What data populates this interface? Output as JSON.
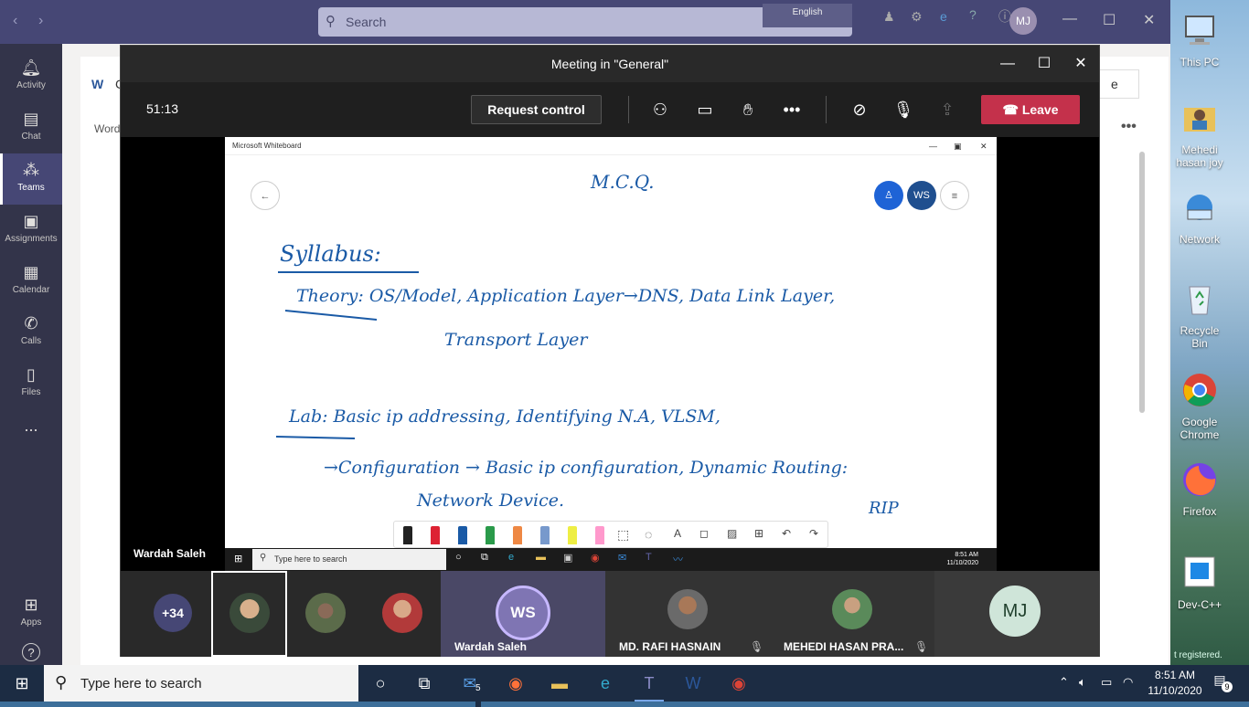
{
  "teams": {
    "search_placeholder": "Search",
    "lang_chip": "English",
    "user_initials": "MJ",
    "doc_letter": "C",
    "word_label": "Word",
    "rail": [
      {
        "label": "Activity",
        "icon": "bell-icon"
      },
      {
        "label": "Chat",
        "icon": "chat-icon"
      },
      {
        "label": "Teams",
        "icon": "teams-icon"
      },
      {
        "label": "Assignments",
        "icon": "assignments-icon"
      },
      {
        "label": "Calendar",
        "icon": "calendar-icon"
      },
      {
        "label": "Calls",
        "icon": "phone-icon"
      },
      {
        "label": "Files",
        "icon": "files-icon"
      },
      {
        "label": "...",
        "icon": "more-icon"
      },
      {
        "label": "Apps",
        "icon": "apps-icon"
      },
      {
        "label": "?",
        "icon": "help-icon"
      }
    ],
    "side_button_partial": "e"
  },
  "meeting": {
    "title": "Meeting in \"General\"",
    "timer": "51:13",
    "request_control": "Request control",
    "leave": "Leave",
    "presenter_name": "Wardah Saleh",
    "whiteboard": {
      "window_title": "Microsoft Whiteboard",
      "presence": [
        "WS"
      ],
      "ink_lines": [
        "M.C.Q.",
        "Syllabus:",
        "Theory: OS/Model, Application Layer→DNS, Data Link Layer,",
        "Transport Layer",
        "Lab: Basic ip addressing, Identifying N.A, VLSM,",
        "→Configuration → Basic ip configuration, Dynamic Routing:",
        "Network Device.",
        "RIP"
      ],
      "inner_taskbar": {
        "search_placeholder": "Type here to search",
        "time": "8:51 AM",
        "date": "11/10/2020"
      }
    },
    "gallery": {
      "overflow_count": "+34",
      "tiles": [
        {
          "name": "Wardah Saleh",
          "initials": "WS"
        },
        {
          "name": "MD. RAFI HASNAIN"
        },
        {
          "name": "MEHEDI HASAN PRA..."
        },
        {
          "initials": "MJ"
        }
      ]
    }
  },
  "desktop": {
    "icons": [
      {
        "label": "This PC",
        "icon": "computer-icon"
      },
      {
        "label": "Mehedi hasan joy",
        "icon": "user-folder-icon"
      },
      {
        "label": "Network",
        "icon": "network-icon"
      },
      {
        "label": "Recycle Bin",
        "icon": "recycle-bin-icon"
      },
      {
        "label": "Google Chrome",
        "icon": "chrome-icon"
      },
      {
        "label": "Firefox",
        "icon": "firefox-icon"
      },
      {
        "label": "Dev-C++",
        "icon": "devcpp-icon"
      }
    ],
    "watermark": "t registered."
  },
  "taskbar": {
    "search_placeholder": "Type here to search",
    "mail_badge": "5",
    "time": "8:51 AM",
    "date": "11/10/2020",
    "notif_count": "9"
  },
  "colors": {
    "teams_header": "#464775",
    "rail": "#33344a",
    "leave": "#c4314b",
    "ink": "#1a5aa6",
    "taskbar": "#1c2c43"
  }
}
